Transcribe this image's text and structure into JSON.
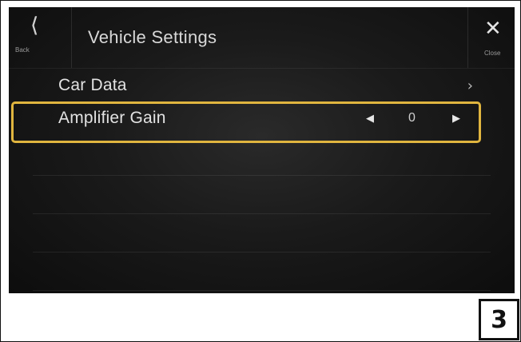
{
  "header": {
    "back_icon": "double-chevron-left",
    "back_label": "Back",
    "title": "Vehicle Settings",
    "close_icon": "close-x",
    "close_label": "Close"
  },
  "rows": [
    {
      "label": "Car Data",
      "trailing_icon": "chevron-right"
    },
    {
      "label": "Amplifier Gain",
      "value": "0",
      "left_icon": "triangle-left",
      "right_icon": "triangle-right",
      "highlighted": true
    }
  ],
  "page_number": "3",
  "colors": {
    "highlight": "#e0b53f",
    "screen_bg": "#1a1a1a"
  }
}
